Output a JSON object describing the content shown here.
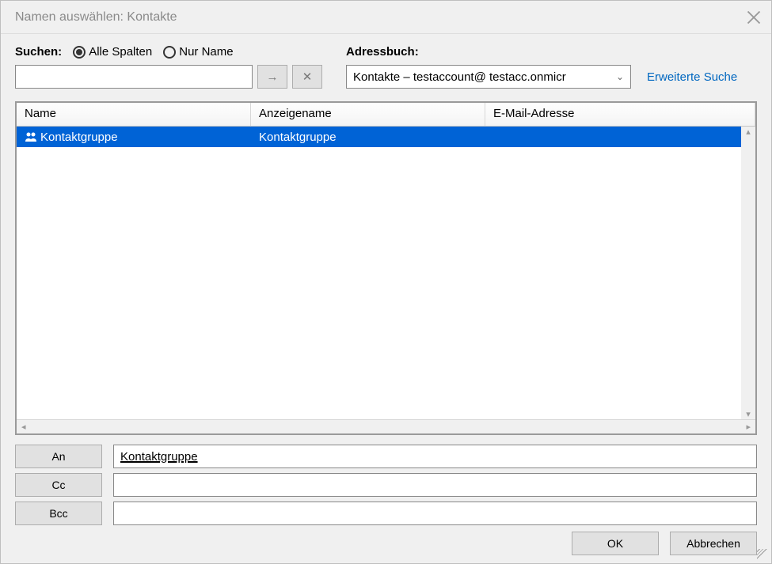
{
  "title": "Namen auswählen: Kontakte",
  "search": {
    "label": "Suchen:",
    "radio_all": "Alle Spalten",
    "radio_name": "Nur Name",
    "value": ""
  },
  "addressbook": {
    "label": "Adressbuch:",
    "selected": "Kontakte – testaccount@ testacc.onmicr",
    "advanced": "Erweiterte Suche"
  },
  "columns": {
    "name": "Name",
    "display": "Anzeigename",
    "email": "E-Mail-Adresse"
  },
  "rows": [
    {
      "name": "Kontaktgruppe",
      "display": "Kontaktgruppe",
      "email": ""
    }
  ],
  "recipients": {
    "to_label": "An",
    "cc_label": "Cc",
    "bcc_label": "Bcc",
    "to_value": "Kontaktgruppe",
    "cc_value": "",
    "bcc_value": ""
  },
  "footer": {
    "ok": "OK",
    "cancel": "Abbrechen"
  }
}
